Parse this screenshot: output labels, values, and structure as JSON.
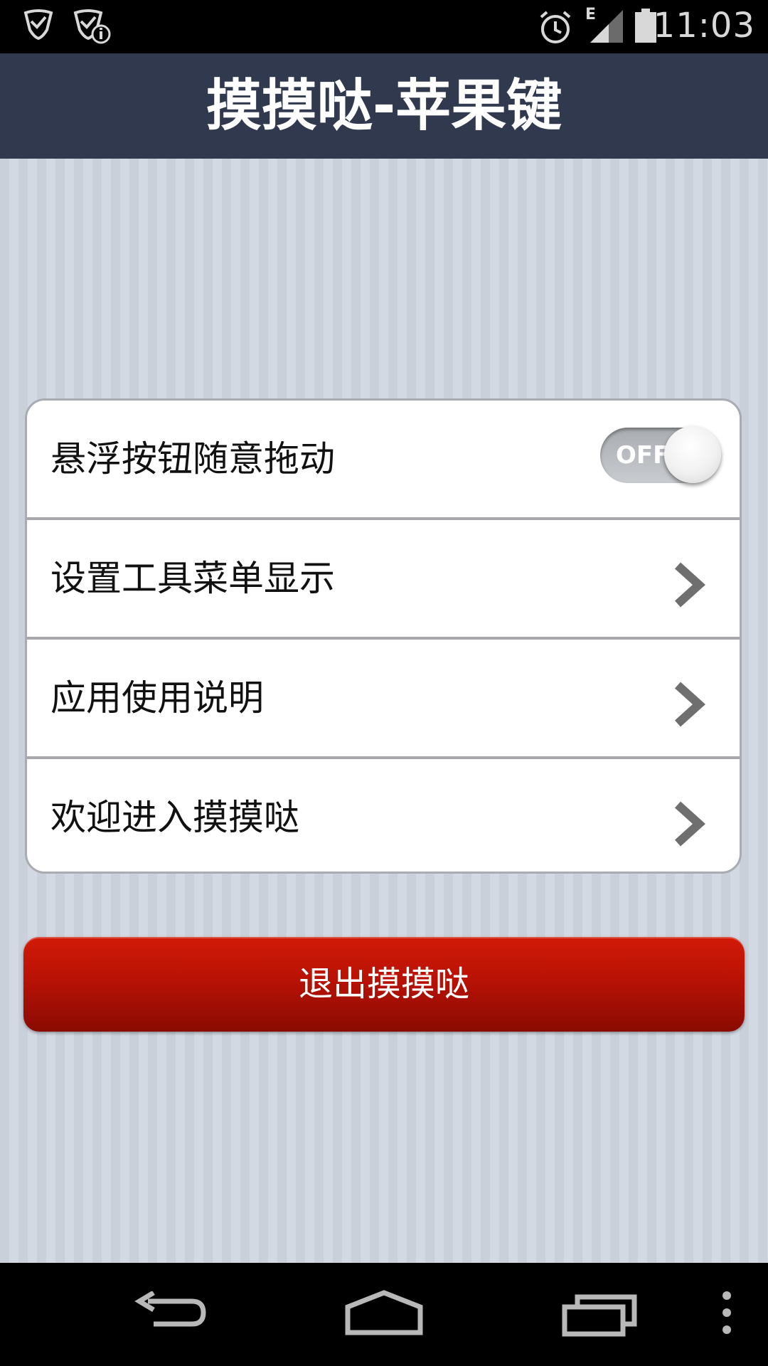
{
  "status_bar": {
    "time": "11:03",
    "network_type": "E",
    "icons": [
      "shield-check-icon",
      "shield-info-icon",
      "alarm-clock-icon",
      "signal-icon",
      "battery-icon"
    ]
  },
  "header": {
    "title": "摸摸哒-苹果键"
  },
  "settings": {
    "items": [
      {
        "label": "悬浮按钮随意拖动",
        "control": "toggle",
        "toggle_state": "OFF"
      },
      {
        "label": "设置工具菜单显示",
        "control": "chevron-right-icon"
      },
      {
        "label": "应用使用说明",
        "control": "chevron-right-icon"
      },
      {
        "label": "欢迎进入摸摸哒",
        "control": "chevron-right-icon"
      }
    ]
  },
  "exit_button": {
    "label": "退出摸摸哒",
    "color": "#b81205"
  },
  "nav_bar": {
    "icons": [
      "back-icon",
      "home-icon",
      "recent-apps-icon",
      "overflow-menu-icon"
    ]
  },
  "colors": {
    "title_bar": "#30394d",
    "background_stripes": [
      "#c9d0da",
      "#d3d9e2"
    ],
    "card": "#ffffff",
    "exit_button": "#b81205"
  }
}
